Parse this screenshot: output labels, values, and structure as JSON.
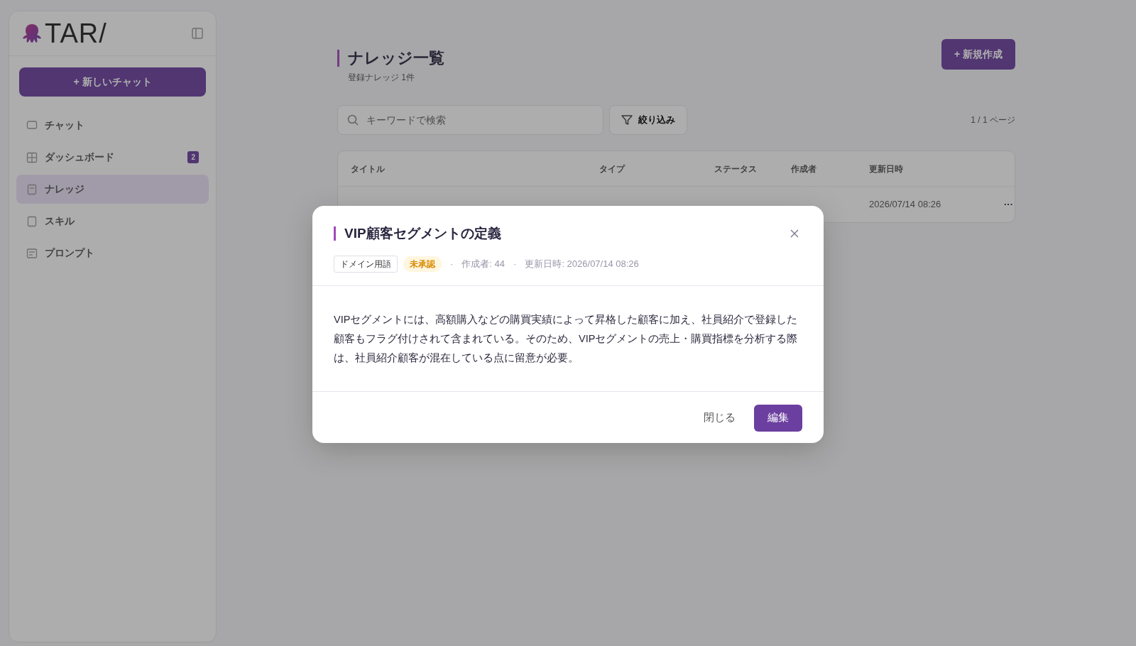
{
  "sidebar": {
    "logo": "TAR/",
    "new_chat": "+ 新しいチャット",
    "items": [
      {
        "label": "チャット",
        "selected": false
      },
      {
        "label": "ダッシュボード",
        "selected": false,
        "badge": "2"
      },
      {
        "label": "ナレッジ",
        "selected": true
      },
      {
        "label": "スキル",
        "selected": false
      },
      {
        "label": "プロンプト",
        "selected": false
      }
    ]
  },
  "main": {
    "title": "ナレッジ一覧",
    "subtitle": "登録ナレッジ 1件",
    "create_button": "+ 新規作成",
    "search": {
      "placeholder": "キーワードで検索"
    },
    "filter_button": "絞り込み",
    "pagination": "1 / 1 ページ",
    "table": {
      "columns": [
        "タイトル",
        "タイプ",
        "ステータス",
        "作成者",
        "更新日時"
      ],
      "rows": [
        {
          "updated": "2026/07/14 08:26",
          "menu": "···"
        }
      ]
    }
  },
  "modal": {
    "title": "VIP顧客セグメントの定義",
    "meta": [
      {
        "kind": "tag",
        "text": "ドメイン用語"
      },
      {
        "kind": "status",
        "text": "未承認"
      },
      {
        "kind": "separator",
        "text": "·"
      },
      {
        "kind": "info",
        "text": "作成者: 44"
      },
      {
        "kind": "separator",
        "text": "·"
      },
      {
        "kind": "info",
        "text": "更新日時: 2026/07/14 08:26"
      }
    ],
    "body": "VIPセグメントには、高額購入などの購買実績によって昇格した顧客に加え、社員紹介で登録した顧客もフラグ付けされて含まれている。そのため、VIPセグメントの売上・購買指標を分析する際は、社員紹介顧客が混在している点に留意が必要。",
    "close_button": "閉じる",
    "edit_button": "編集"
  }
}
